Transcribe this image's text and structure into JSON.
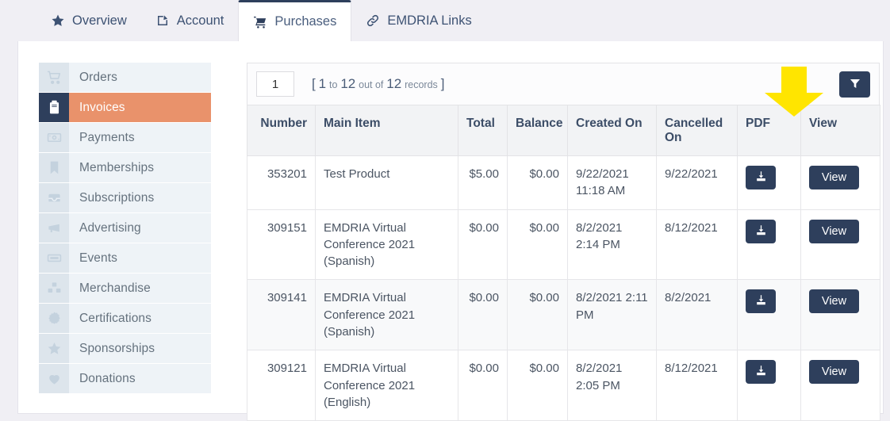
{
  "tabs": [
    {
      "label": "Overview",
      "icon": "star-icon",
      "active": false
    },
    {
      "label": "Account",
      "icon": "edit-square-icon",
      "active": false
    },
    {
      "label": "Purchases",
      "icon": "shopping-cart-icon",
      "active": true
    },
    {
      "label": "EMDRIA Links",
      "icon": "link-icon",
      "active": false
    }
  ],
  "sidebar": {
    "items": [
      {
        "label": "Orders",
        "icon": "cart-icon",
        "active": false
      },
      {
        "label": "Invoices",
        "icon": "clipboard-icon",
        "active": true
      },
      {
        "label": "Payments",
        "icon": "banknote-icon",
        "active": false
      },
      {
        "label": "Memberships",
        "icon": "bookmark-icon",
        "active": false
      },
      {
        "label": "Subscriptions",
        "icon": "inbox-icon",
        "active": false
      },
      {
        "label": "Advertising",
        "icon": "megaphone-icon",
        "active": false
      },
      {
        "label": "Events",
        "icon": "ticket-icon",
        "active": false
      },
      {
        "label": "Merchandise",
        "icon": "boxes-icon",
        "active": false
      },
      {
        "label": "Certifications",
        "icon": "rosette-icon",
        "active": false
      },
      {
        "label": "Sponsorships",
        "icon": "star-icon",
        "active": false
      },
      {
        "label": "Donations",
        "icon": "heart-icon",
        "active": false
      }
    ]
  },
  "toolbar": {
    "page_value": "1",
    "page_placeholder": "1",
    "records_open_bracket": "[",
    "records_from": "1",
    "records_to_word": "to",
    "records_to": "12",
    "records_outof_word": "out of",
    "records_total": "12",
    "records_word": "records",
    "records_close_bracket": "]",
    "filter_icon": "filter-funnel-icon"
  },
  "table": {
    "columns": [
      "Number",
      "Main Item",
      "Total",
      "Balance",
      "Created On",
      "Cancelled On",
      "PDF",
      "View"
    ],
    "pdf_button_icon": "download-icon",
    "view_button_label": "View",
    "rows": [
      {
        "number": "353201",
        "main_item": "Test Product",
        "total": "$5.00",
        "balance": "$0.00",
        "created_on": "9/22/2021 11:18 AM",
        "cancelled_on": "9/22/2021"
      },
      {
        "number": "309151",
        "main_item": "EMDRIA Virtual Conference 2021 (Spanish)",
        "total": "$0.00",
        "balance": "$0.00",
        "created_on": "8/2/2021 2:14 PM",
        "cancelled_on": "8/12/2021"
      },
      {
        "number": "309141",
        "main_item": "EMDRIA Virtual Conference 2021 (Spanish)",
        "total": "$0.00",
        "balance": "$0.00",
        "created_on": "8/2/2021 2:11 PM",
        "cancelled_on": "8/2/2021"
      },
      {
        "number": "309121",
        "main_item": "EMDRIA Virtual Conference 2021 (English)",
        "total": "$0.00",
        "balance": "$0.00",
        "created_on": "8/2/2021 2:05 PM",
        "cancelled_on": "8/12/2021"
      }
    ]
  },
  "annotation": {
    "type": "arrow-down",
    "color": "#ffe500",
    "target": "PDF column"
  },
  "colors": {
    "navy": "#2e3f5c",
    "salmon": "#e9926b",
    "page_bg": "#f0eff4",
    "sidebar_icon_bg": "#dde5ec",
    "sidebar_label_bg": "#eef3f7",
    "annotation_yellow": "#ffe500"
  }
}
